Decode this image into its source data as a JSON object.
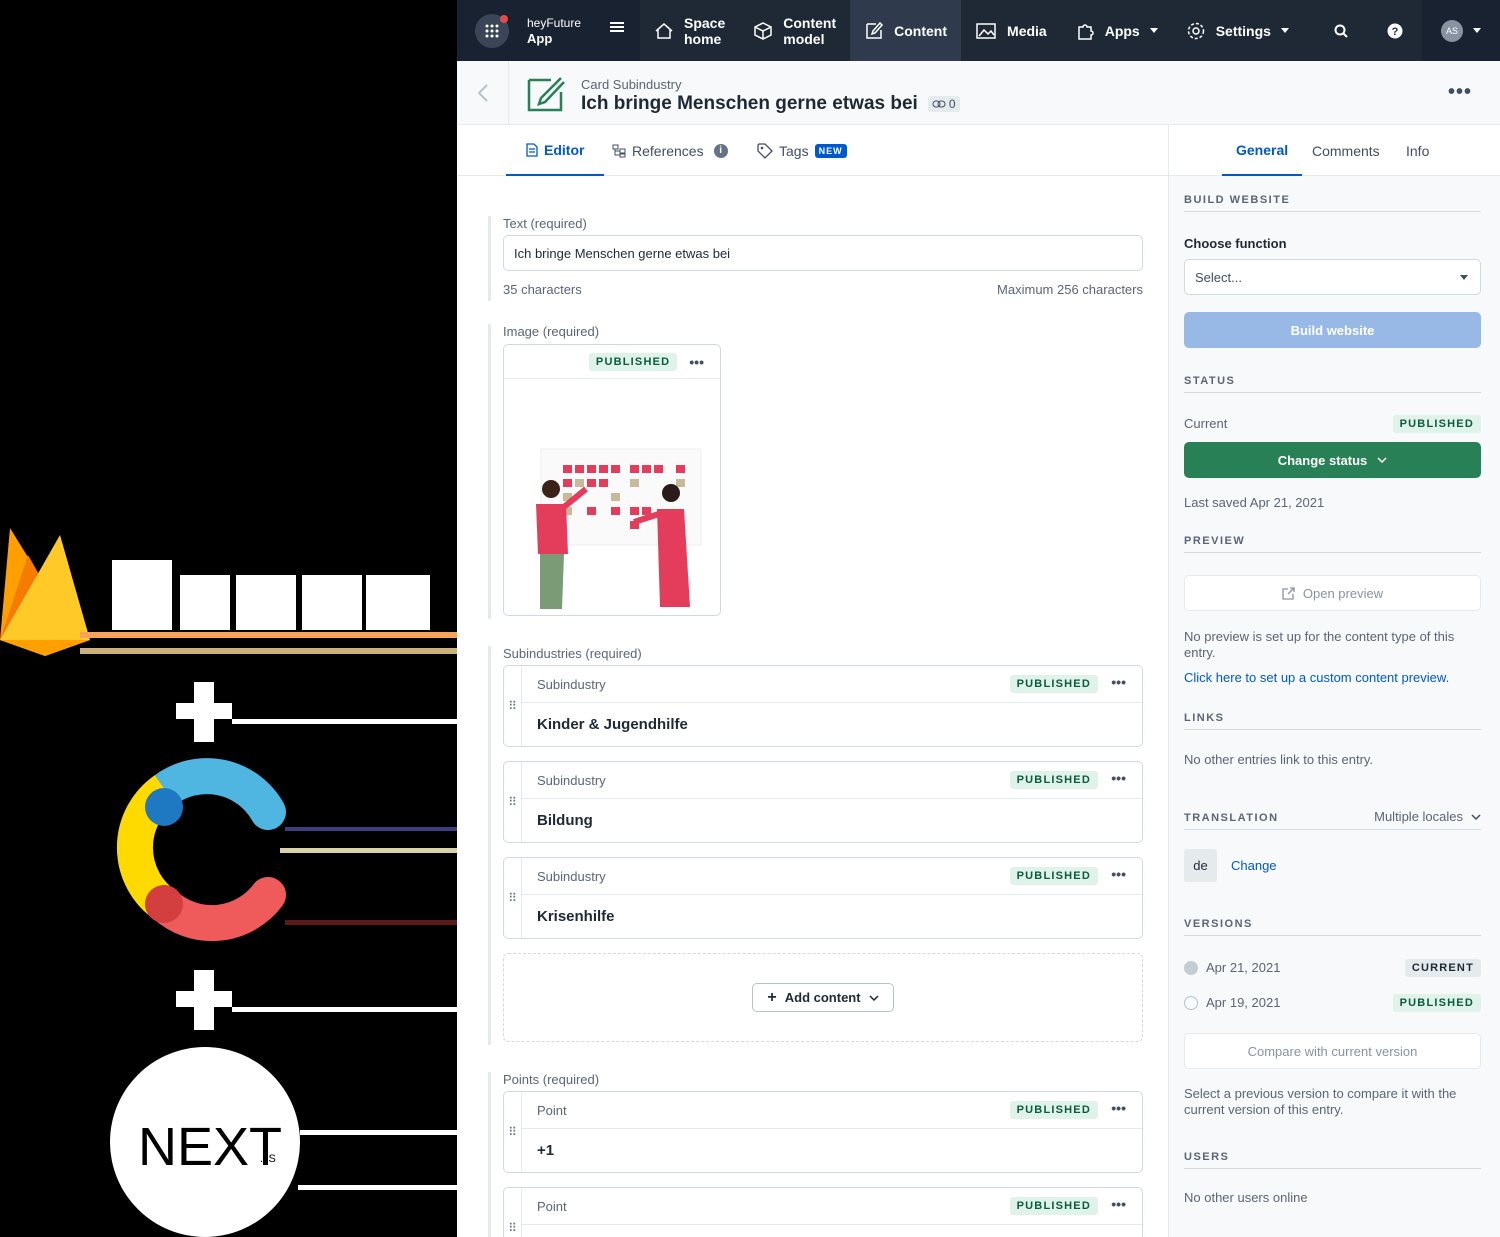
{
  "nav": {
    "org_line1": "heyFuture",
    "org_line2": "App",
    "space_home_1": "Space",
    "space_home_2": "home",
    "content_model_1": "Content",
    "content_model_2": "model",
    "content": "Content",
    "media": "Media",
    "apps": "Apps",
    "settings": "Settings",
    "avatar_initials": "AS"
  },
  "entry": {
    "type": "Card Subindustry",
    "title": "Ich bringe Menschen gerne etwas bei",
    "ref_count": "0"
  },
  "tabs": {
    "editor": "Editor",
    "references": "References",
    "tags": "Tags",
    "tags_badge": "NEW",
    "info_glyph": "i"
  },
  "fields": {
    "text": {
      "label": "Text (required)",
      "value": "Ich bringe Menschen gerne etwas bei",
      "count": "35 characters",
      "max": "Maximum 256 characters"
    },
    "image": {
      "label": "Image (required)",
      "status": "PUBLISHED"
    },
    "subindustries": {
      "label": "Subindustries (required)",
      "items": [
        {
          "type": "Subindustry",
          "title": "Kinder & Jugendhilfe",
          "status": "PUBLISHED"
        },
        {
          "type": "Subindustry",
          "title": "Bildung",
          "status": "PUBLISHED"
        },
        {
          "type": "Subindustry",
          "title": "Krisenhilfe",
          "status": "PUBLISHED"
        }
      ],
      "add_label": "Add content"
    },
    "points": {
      "label": "Points (required)",
      "items": [
        {
          "type": "Point",
          "title": "+1",
          "status": "PUBLISHED"
        },
        {
          "type": "Point",
          "title": "",
          "status": "PUBLISHED"
        }
      ]
    }
  },
  "sidebar": {
    "tabs": {
      "general": "General",
      "comments": "Comments",
      "info": "Info"
    },
    "build": {
      "heading": "BUILD WEBSITE",
      "choose_label": "Choose function",
      "select_placeholder": "Select...",
      "button": "Build website"
    },
    "status": {
      "heading": "STATUS",
      "current_label": "Current",
      "current_badge": "PUBLISHED",
      "button": "Change status",
      "last_saved": "Last saved Apr 21, 2021"
    },
    "preview": {
      "heading": "PREVIEW",
      "button": "Open preview",
      "note": "No preview is set up for the content type of this entry.",
      "link": "Click here to set up a custom content preview."
    },
    "links": {
      "heading": "LINKS",
      "note": "No other entries link to this entry."
    },
    "translation": {
      "heading": "TRANSLATION",
      "mode": "Multiple locales",
      "locale": "de",
      "change": "Change"
    },
    "versions": {
      "heading": "VERSIONS",
      "items": [
        {
          "date": "Apr 21, 2021",
          "badge": "CURRENT"
        },
        {
          "date": "Apr 19, 2021",
          "badge": "PUBLISHED"
        }
      ],
      "compare_button": "Compare with current version",
      "note": "Select a previous version to compare it with the current version of this entry."
    },
    "users": {
      "heading": "USERS",
      "note": "No other users online"
    }
  },
  "left_logos": {
    "plus": "+",
    "nextjs_main": "NEXT",
    "nextjs_suffix": ".JS"
  },
  "colors": {
    "nav_bg": "#1f2936",
    "accent": "#0059c8",
    "published_green": "#278056",
    "firebase_yellow": "#ffca28",
    "firebase_orange": "#f57c00",
    "contentful_blue": "#4fb5e1",
    "contentful_yellow": "#ffda00",
    "contentful_red": "#ef5a5a"
  }
}
